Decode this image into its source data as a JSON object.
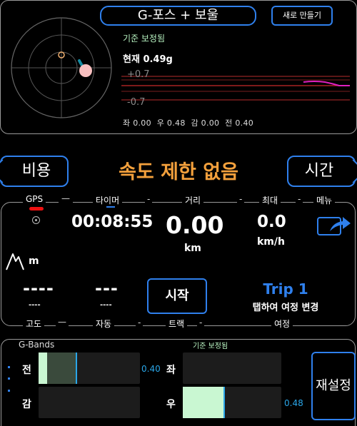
{
  "gforce": {
    "title": "G-포스 + 보울",
    "new_button": "새로 만들기",
    "calibrated": "기준 보정됨",
    "current": "현재 0.49g",
    "trace_plus": "+0.7",
    "trace_minus": "-0.7",
    "readout": {
      "left": "좌 0.00",
      "right": "우 0.48",
      "decel": "감 0.00",
      "accel": "전 0.40"
    }
  },
  "speed_row": {
    "cost_button": "비용",
    "time_button": "시간",
    "speed_limit": "속도 제한 없음"
  },
  "trip": {
    "gps_label": "GPS",
    "timer_label": "타이머",
    "distance_label": "거리",
    "max_label": "최대",
    "menu_label": "메뉴",
    "timer_value": "00:08:55",
    "distance_value": "0.00",
    "distance_unit": "km",
    "max_value": "0.0",
    "max_unit": "km/h",
    "altitude_unit": "m",
    "altitude_value": "----",
    "altitude_sub": "----",
    "auto_value": "---",
    "auto_sub": "----",
    "start_button": "시작",
    "trip_name": "Trip 1",
    "trip_hint": "탭하여 여정 변경",
    "altitude_label": "고도",
    "auto_label": "자동",
    "track_label": "트랙",
    "journey_label": "여정",
    "separator": "-"
  },
  "gbands": {
    "title": "G-Bands",
    "calibrated": "기준 보정됨",
    "accel_label": "전",
    "decel_label": "감",
    "left_label": "좌",
    "right_label": "우",
    "accel_value": "0.40",
    "right_value": "0.48",
    "reset_button": "재설정"
  },
  "colors": {
    "accent": "#2f80ed",
    "speed_limit": "#f3a03c",
    "calibrated": "#b9f5c2",
    "gps_status": "#e11111",
    "band_fill": "#c9f7d2",
    "marker": "#2aa6e8"
  }
}
